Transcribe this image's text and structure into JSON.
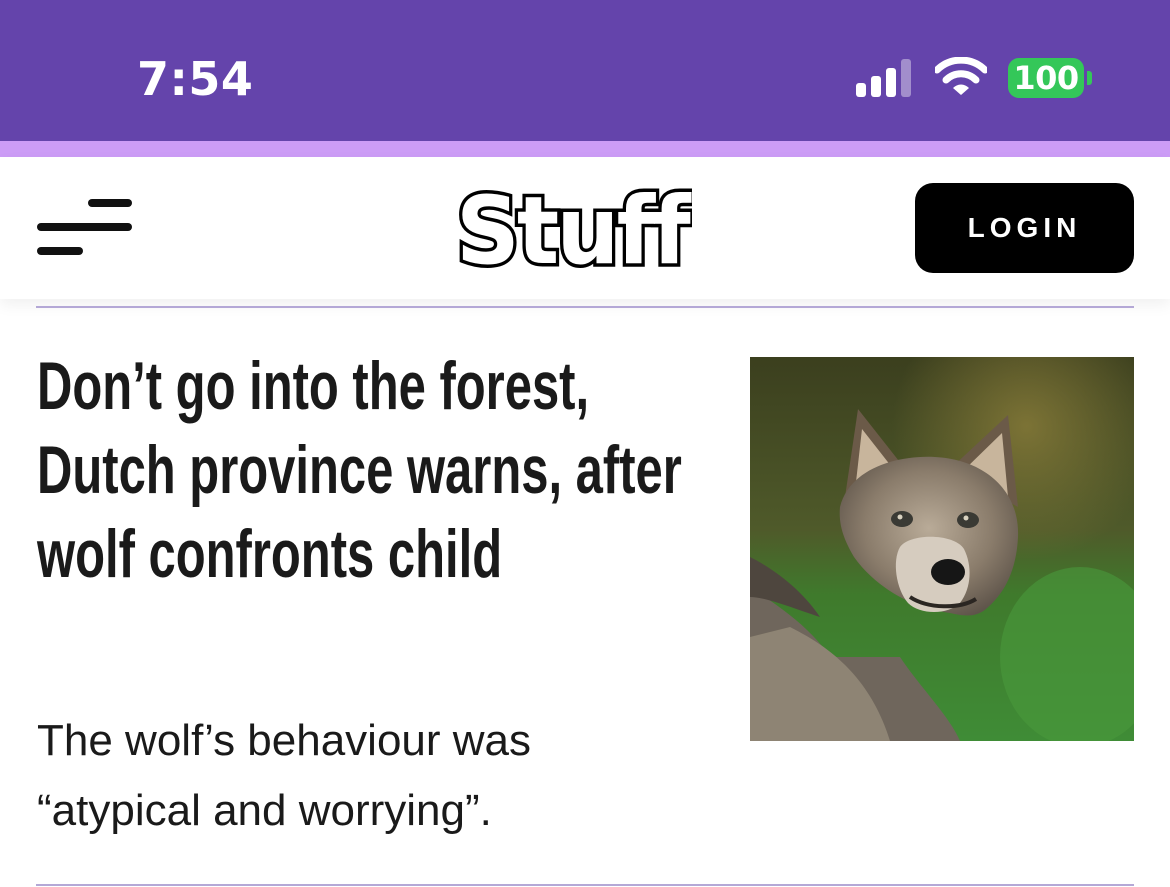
{
  "status_bar": {
    "time": "7:54",
    "battery_level": "100",
    "icons": [
      "signal-icon",
      "wifi-icon",
      "battery-icon"
    ]
  },
  "header": {
    "logo_text": "Stuff",
    "login_label": "LOGIN",
    "icons": [
      "hamburger-menu-icon"
    ]
  },
  "colors": {
    "status_bar_bg": "#6444ab",
    "accent_strip": "#cc9cf6",
    "divider": "#b4a8d6",
    "battery_green": "#34c759",
    "login_bg": "#000000"
  },
  "article": {
    "headline": "Don’t go into the forest, Dutch province warns, after wolf confronts child",
    "summary": "The wolf’s behaviour was “atypical and worrying”.",
    "image": "wolf-photo"
  }
}
